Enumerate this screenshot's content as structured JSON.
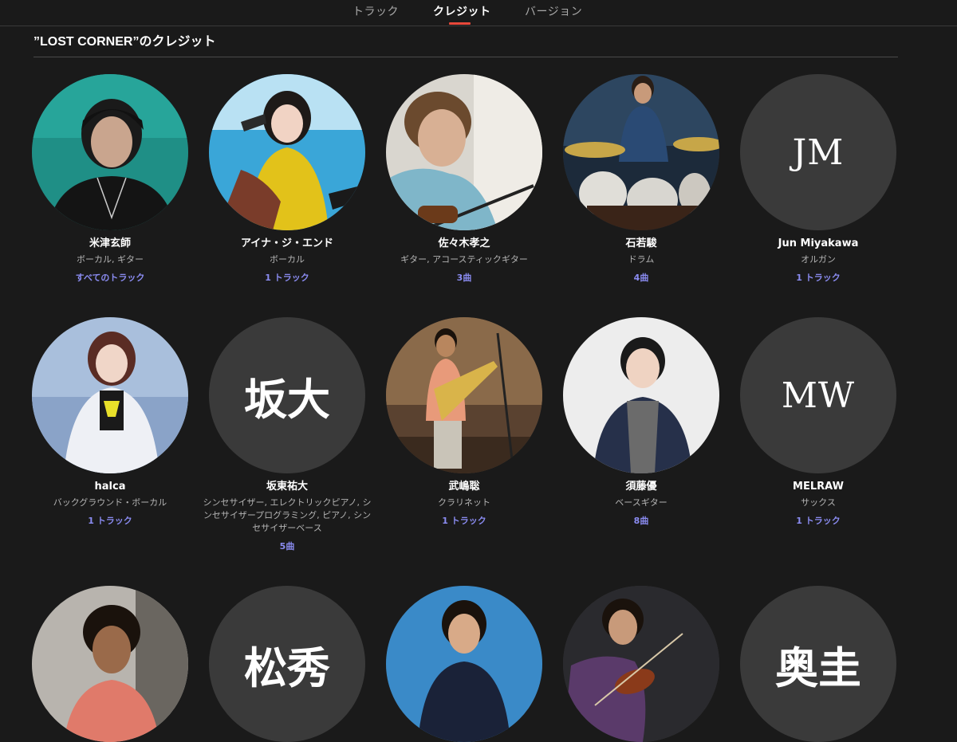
{
  "tabs": [
    {
      "label": "トラック"
    },
    {
      "label": "クレジット"
    },
    {
      "label": "バージョン"
    }
  ],
  "heading": "”LOST CORNER”のクレジット",
  "credits": [
    {
      "name": "米津玄師",
      "role": "ボーカル, ギター",
      "tracks": "すべてのトラック",
      "photo": "teal-portrait"
    },
    {
      "name": "アイナ・ジ・エンド",
      "role": "ボーカル",
      "tracks": "1 トラック",
      "photo": "yellow-portrait"
    },
    {
      "name": "佐々木孝之",
      "role": "ギター, アコースティックギター",
      "tracks": "3曲",
      "photo": "guitar-portrait"
    },
    {
      "name": "石若駿",
      "role": "ドラム",
      "tracks": "4曲",
      "photo": "drums-portrait"
    },
    {
      "name": "Jun Miyakawa",
      "role": "オルガン",
      "tracks": "1 トラック",
      "initials": "JM"
    },
    {
      "name": "halca",
      "role": "バックグラウンド・ボーカル",
      "tracks": "1 トラック",
      "photo": "white-jacket-portrait"
    },
    {
      "name": "坂東祐大",
      "role": "シンセサイザー, エレクトリックピアノ, シンセサイザープログラミング, ピアノ, シンセサイザーベース",
      "tracks": "5曲",
      "initials": "坂大"
    },
    {
      "name": "武嶋聡",
      "role": "クラリネット",
      "tracks": "1 トラック",
      "photo": "sax-portrait"
    },
    {
      "name": "須藤優",
      "role": "ベースギター",
      "tracks": "8曲",
      "photo": "denim-portrait"
    },
    {
      "name": "MELRAW",
      "role": "サックス",
      "tracks": "1 トラック",
      "initials": "MW"
    },
    {
      "photo": "pink-hoodie-portrait"
    },
    {
      "initials": "松秀"
    },
    {
      "photo": "blue-bg-portrait"
    },
    {
      "photo": "violin-portrait"
    },
    {
      "initials": "奥圭"
    }
  ],
  "colors": {
    "background": "#1a1a1a",
    "accent_underline": "#e8483a",
    "track_link": "#8b8cf2",
    "placeholder_avatar": "#3a3a3a"
  }
}
